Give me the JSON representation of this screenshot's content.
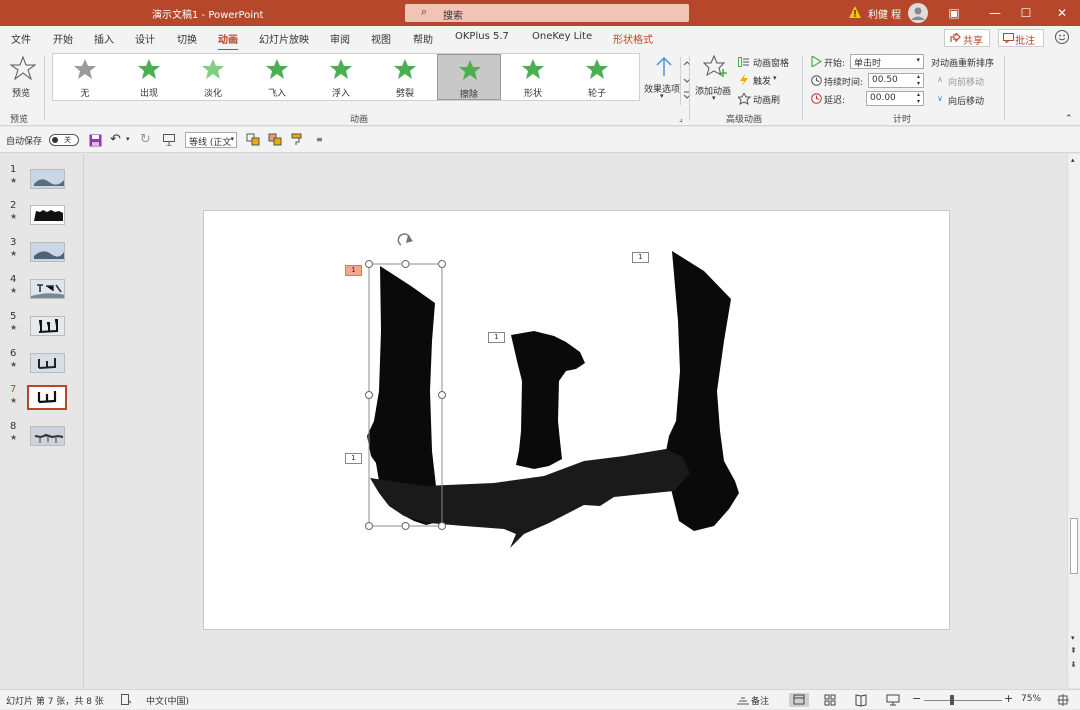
{
  "window": {
    "title": "演示文稿1  -  PowerPoint",
    "search_placeholder": "搜索",
    "user": "利健 程",
    "ribbon_display": "▣",
    "minimize": "—",
    "maximize": "☐",
    "close": "✕"
  },
  "tabs": [
    "文件",
    "开始",
    "插入",
    "设计",
    "切换",
    "动画",
    "幻灯片放映",
    "审阅",
    "视图",
    "帮助",
    "OKPlus 5.7",
    "OneKey Lite",
    "形状格式"
  ],
  "active_tab": "动画",
  "share": "共享",
  "comments": "批注",
  "ribbon": {
    "preview": {
      "label": "预览",
      "group": "预览"
    },
    "animations": {
      "group": "动画",
      "items": [
        {
          "label": "无",
          "color": "#9a9a9a"
        },
        {
          "label": "出现",
          "color": "#4caf50"
        },
        {
          "label": "淡化",
          "color": "#4caf50"
        },
        {
          "label": "飞入",
          "color": "#4caf50"
        },
        {
          "label": "浮入",
          "color": "#4caf50"
        },
        {
          "label": "劈裂",
          "color": "#4caf50"
        },
        {
          "label": "擦除",
          "color": "#4caf50"
        },
        {
          "label": "形状",
          "color": "#4caf50"
        },
        {
          "label": "轮子",
          "color": "#4caf50"
        }
      ],
      "selected": "擦除",
      "effect_options": "效果选项"
    },
    "advanced": {
      "group": "高级动画",
      "add_animation": "添加动画",
      "pane": "动画窗格",
      "trigger": "触发",
      "painter": "动画刷"
    },
    "timing": {
      "group": "计时",
      "start_label": "开始:",
      "start_value": "单击时",
      "duration_label": "持续时间:",
      "duration_value": "00.50",
      "delay_label": "延迟:",
      "delay_value": "00.00",
      "reorder": "对动画重新排序",
      "move_earlier": "向前移动",
      "move_later": "向后移动"
    }
  },
  "qat": {
    "autosave": "自动保存",
    "autosave_state": "关",
    "font": "等线 (正文"
  },
  "slides": [
    {
      "num": "1",
      "star": "★"
    },
    {
      "num": "2",
      "star": "★"
    },
    {
      "num": "3",
      "star": "★"
    },
    {
      "num": "4",
      "star": "★"
    },
    {
      "num": "5",
      "star": "★"
    },
    {
      "num": "6",
      "star": "★"
    },
    {
      "num": "7",
      "star": "★"
    },
    {
      "num": "8",
      "star": "★"
    }
  ],
  "active_slide": "7",
  "anim_tags": [
    "1",
    "1",
    "1",
    "1"
  ],
  "status": {
    "slide_info": "幻灯片 第 7 张，共 8 张",
    "language": "中文(中国)",
    "notes": "备注",
    "zoom": "75%"
  }
}
